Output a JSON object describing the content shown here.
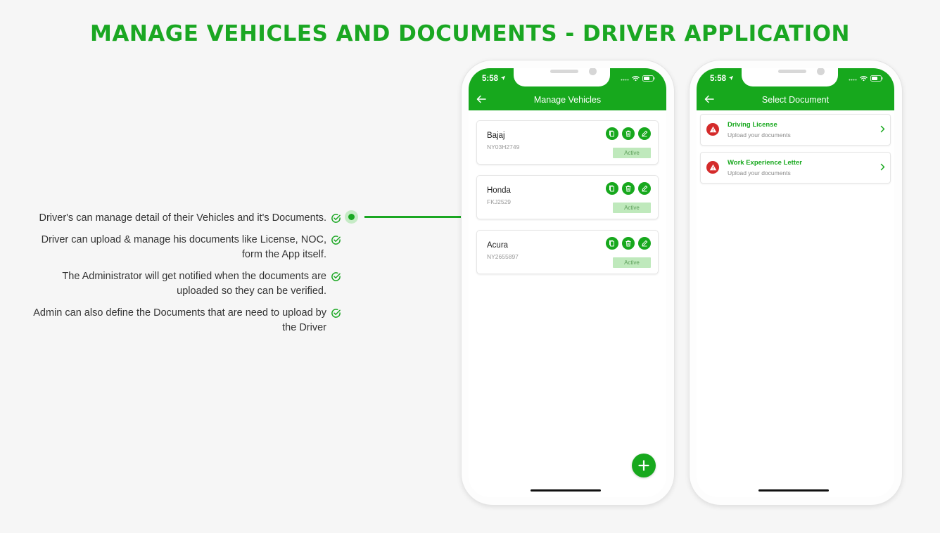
{
  "page": {
    "title": "MANAGE VEHICLES AND DOCUMENTS - DRIVER APPLICATION"
  },
  "features": [
    {
      "text": "Driver's can manage detail of their Vehicles and it's Documents."
    },
    {
      "text": "Driver can upload & manage his documents like License, NOC, form the App itself."
    },
    {
      "text": "The Administrator will get notified when the documents are uploaded so they can be verified."
    },
    {
      "text": "Admin can also define the Documents that are need to upload by the Driver"
    }
  ],
  "phone1": {
    "time": "5:58",
    "title": "Manage Vehicles",
    "vehicles": [
      {
        "name": "Bajaj",
        "plate": "NY03H2749",
        "status": "Active"
      },
      {
        "name": "Honda",
        "plate": "FKJ2529",
        "status": "Active"
      },
      {
        "name": "Acura",
        "plate": "NY2655897",
        "status": "Active"
      }
    ]
  },
  "phone2": {
    "time": "5:58",
    "title": "Select Document",
    "documents": [
      {
        "title": "Driving License",
        "subtitle": "Upload your documents"
      },
      {
        "title": "Work Experience Letter",
        "subtitle": "Upload your documents"
      }
    ]
  },
  "colors": {
    "brand_green": "#17a81d",
    "warning_red": "#d42a2a",
    "badge_bg": "#bfe9bc"
  }
}
